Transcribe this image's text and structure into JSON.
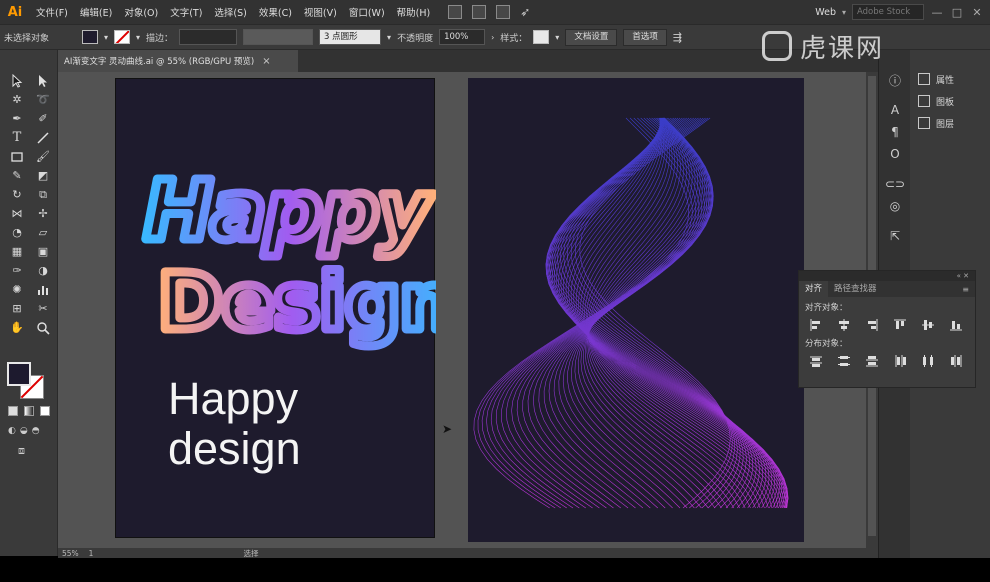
{
  "app": {
    "logo": "Ai"
  },
  "menubar": {
    "items": [
      "文件(F)",
      "编辑(E)",
      "对象(O)",
      "文字(T)",
      "选择(S)",
      "效果(C)",
      "视图(V)",
      "窗口(W)",
      "帮助(H)"
    ],
    "workspace": "Web",
    "search_placeholder": "Adobe Stock",
    "window_buttons": [
      "—",
      "□",
      "✕"
    ]
  },
  "controlbar": {
    "selection_status": "未选择对象",
    "stroke_label": "描边：",
    "brush_dropdown": "3 点圆形",
    "opacity_label": "不透明度",
    "opacity_value": "100%",
    "style_label": "样式：",
    "doc_setup_button": "文档设置",
    "preferences_button": "首选项"
  },
  "document_tab": {
    "label": "AI渐变文字 灵动曲线.ai @ 55% (RGB/GPU 预览)",
    "close": "×"
  },
  "artboard1": {
    "gradient_text_line1": "Happy",
    "gradient_text_line2": "Design",
    "plain_text_line1": "Happy",
    "plain_text_line2": "design"
  },
  "statusbar": {
    "zoom": "55%",
    "page": "1",
    "tool": "选择"
  },
  "right_panels": {
    "items": [
      "属性",
      "图板",
      "图层"
    ]
  },
  "watermark": {
    "text": "虎课网"
  },
  "align_panel": {
    "tab_align": "对齐",
    "tab_pathfinder": "路径查找器",
    "section_align": "对齐对象：",
    "section_distribute": "分布对象："
  },
  "colors": {
    "artboard_bg": "#1e1b2d",
    "gradient_blue": "#3ab8ff",
    "gradient_purple": "#a15cf0",
    "gradient_peach": "#ffb07a",
    "wave_blue": "#3b3fd1",
    "wave_magenta": "#c936e0"
  },
  "icons": {
    "tools": [
      "selection-tool-icon",
      "direct-selection-tool-icon",
      "magic-wand-icon",
      "lasso-icon",
      "pen-tool-icon",
      "curvature-icon",
      "type-tool-icon",
      "line-tool-icon",
      "rectangle-tool-icon",
      "paintbrush-icon",
      "shaper-icon",
      "eraser-icon",
      "rotate-icon",
      "scale-icon",
      "width-icon",
      "puppet-warp-icon",
      "shape-builder-icon",
      "perspective-icon",
      "mesh-icon",
      "gradient-icon",
      "eyedropper-icon",
      "blend-icon",
      "symbol-sprayer-icon",
      "graph-icon",
      "artboard-tool-icon",
      "slice-icon",
      "hand-icon",
      "zoom-icon"
    ]
  }
}
